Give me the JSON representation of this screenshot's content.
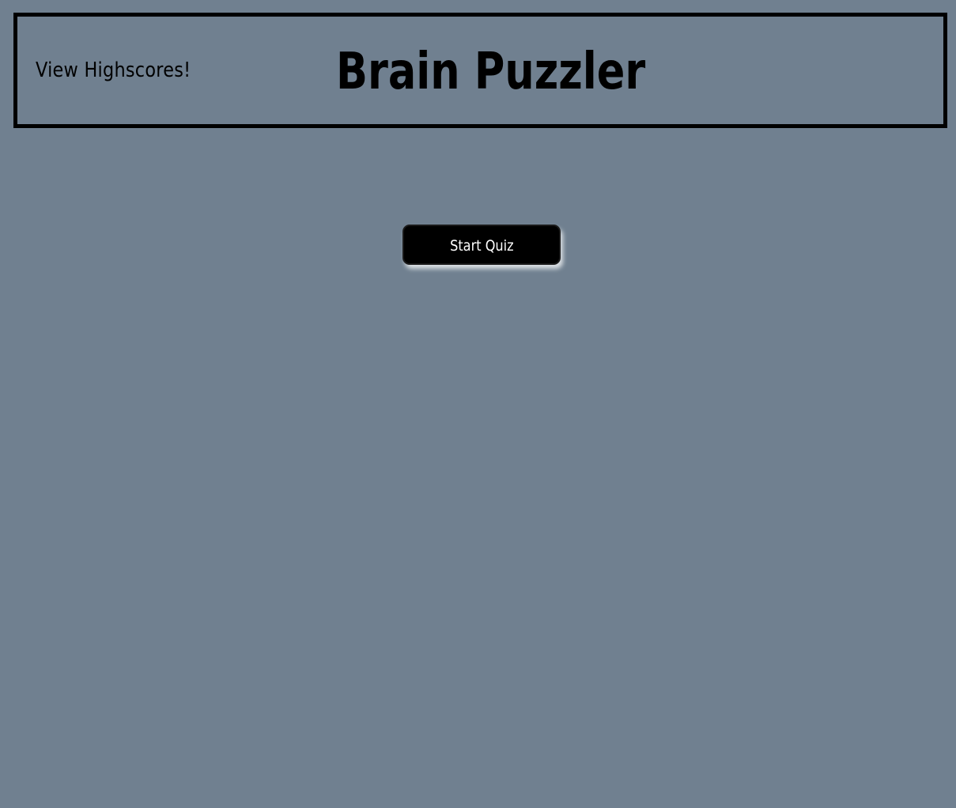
{
  "header": {
    "highscores_link": "View Highscores!",
    "title": "Brain Puzzler"
  },
  "main": {
    "start_button": "Start Quiz"
  },
  "colors": {
    "background": "#708090",
    "border": "#000000",
    "button_background": "#000000",
    "button_text": "#ffffff"
  }
}
